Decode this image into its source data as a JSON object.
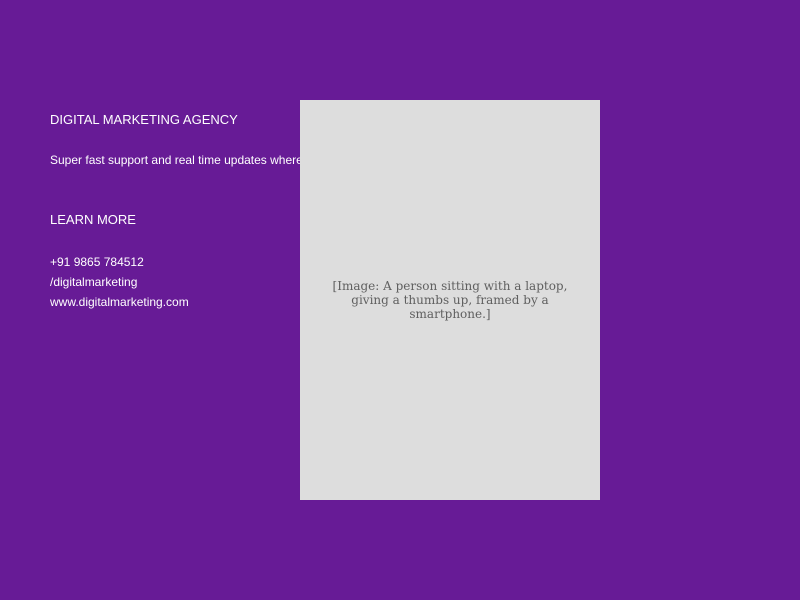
{
  "colors": {
    "background": "#671b96",
    "text": "#ffffff",
    "image_placeholder": "#dddddd",
    "image_caption": "#5f5f5f"
  },
  "agency": {
    "name": "DIGITAL MARKETING AGENCY",
    "tagline": "Super fast support and real time updates where"
  },
  "cta": {
    "learn_more_label": "LEARN MORE"
  },
  "contact": {
    "phone": "+91 9865 784512",
    "social_handle": "/digitalmarketing",
    "website": "www.digitalmarketing.com"
  },
  "hero_image": {
    "caption": "[Image: A person sitting with a laptop, giving a thumbs up, framed by a smartphone.]"
  }
}
